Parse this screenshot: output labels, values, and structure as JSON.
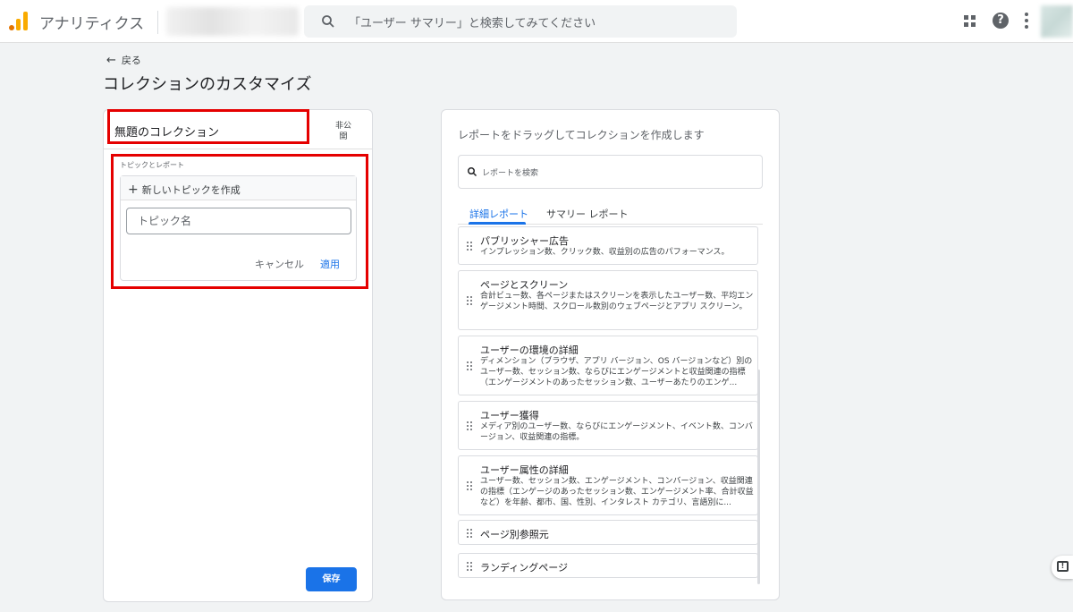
{
  "header": {
    "app_title": "アナリティクス",
    "search_placeholder": "「ユーザー サマリー」と検索してみてください"
  },
  "page": {
    "back_label": "戻る",
    "title": "コレクションのカスタマイズ"
  },
  "collection": {
    "name": "無題のコレクション",
    "visibility": "非公開",
    "topics_label": "トピックとレポート",
    "new_topic_label": "新しいトピックを作成",
    "topic_placeholder": "トピック名",
    "cancel_label": "キャンセル",
    "apply_label": "適用",
    "save_label": "保存"
  },
  "library": {
    "title": "レポートをドラッグしてコレクションを作成します",
    "search_placeholder": "レポートを検索",
    "tabs": [
      "詳細レポート",
      "サマリー レポート"
    ],
    "reports": [
      {
        "name": "パブリッシャー広告",
        "desc": "インプレッション数、クリック数、収益別の広告のパフォーマンス。"
      },
      {
        "name": "ページとスクリーン",
        "desc": "合計ビュー数、各ページまたはスクリーンを表示したユーザー数、平均エンゲージメント時間、スクロール数別のウェブページとアプリ スクリーン。"
      },
      {
        "name": "ユーザーの環境の詳細",
        "desc": "ディメンション（ブラウザ、アプリ バージョン、OS バージョンなど）別のユーザー数、セッション数、ならびにエンゲージメントと収益関連の指標（エンゲージメントのあったセッション数、ユーザーあたりのエンゲ..."
      },
      {
        "name": "ユーザー獲得",
        "desc": "メディア別のユーザー数、ならびにエンゲージメント、イベント数、コンバージョン、収益関連の指標。"
      },
      {
        "name": "ユーザー属性の詳細",
        "desc": "ユーザー数、セッション数、エンゲージメント、コンバージョン、収益関連の指標（エンゲージのあったセッション数、エンゲージメント率、合計収益など）を年齢、都市、国、性別、インタレスト カテゴリ、言語別に..."
      },
      {
        "name": "ページ別参照元",
        "desc": ""
      },
      {
        "name": "ランディングページ",
        "desc": ""
      }
    ]
  },
  "colors": {
    "accent": "#1a73e8",
    "highlight": "#e50000"
  }
}
